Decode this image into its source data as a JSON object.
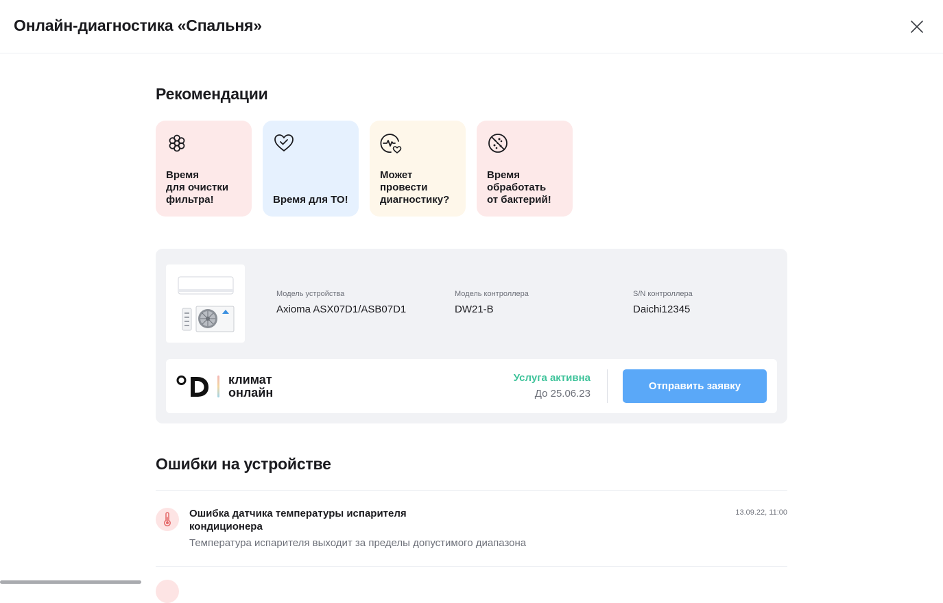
{
  "header": {
    "title": "Онлайн-диагностика «Спальня»"
  },
  "recommendations": {
    "title": "Рекомендации",
    "cards": [
      {
        "text": "Время\nдля очистки\nфильтра!",
        "icon": "filter-flower-icon",
        "bg": "#fde9e9"
      },
      {
        "text": "Время для ТО!",
        "icon": "heart-check-icon",
        "bg": "#e6f1fe"
      },
      {
        "text": "Может\nпровести\nдиагностику?",
        "icon": "pulse-heart-icon",
        "bg": "#fef7ea"
      },
      {
        "text": "Время\nобработать\nот бактерий!",
        "icon": "bacteria-icon",
        "bg": "#fde9e9"
      }
    ]
  },
  "device": {
    "model_label": "Модель устройства",
    "model_value": "Axioma ASX07D1/ASB07D1",
    "controller_label": "Модель контроллера",
    "controller_value": "DW21-B",
    "sn_label": "S/N контроллера",
    "sn_value": "Daichi12345"
  },
  "service": {
    "brand_line1": "климат",
    "brand_line2": "онлайн",
    "brand_text": "климат\nонлайн",
    "status": "Услуга активна",
    "until": "До 25.06.23",
    "submit_label": "Отправить заявку"
  },
  "errors": {
    "title": "Ошибки на устройстве",
    "items": [
      {
        "title": "Ошибка датчика температуры испарителя кондиционера",
        "description": "Температура испарителя выходит за пределы допустимого диапазона",
        "time": "13.09.22, 11:00",
        "icon": "thermometer-icon"
      }
    ]
  },
  "colors": {
    "accent": "#5aa8f8",
    "success": "#3ec39a",
    "error_bg": "#fde4e4"
  }
}
